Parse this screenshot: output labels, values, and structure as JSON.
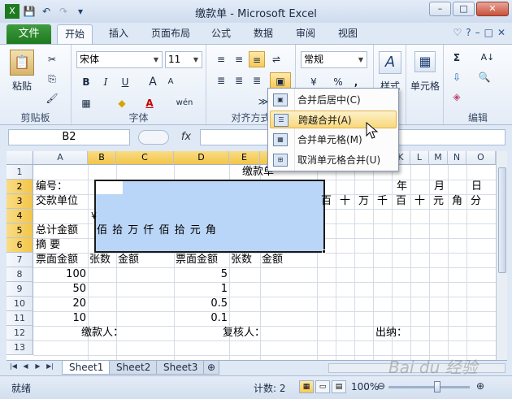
{
  "window": {
    "title": "缴款单 - Microsoft Excel",
    "min": "–",
    "max": "□",
    "close": "✕"
  },
  "qat": {
    "save": "💾",
    "undo": "↶",
    "redo": "↷",
    "more": "▾"
  },
  "tabs": {
    "file": "文件",
    "items": [
      "开始",
      "插入",
      "页面布局",
      "公式",
      "数据",
      "审阅",
      "视图"
    ],
    "active": "开始",
    "icons": [
      "♡",
      "?",
      "–",
      "□",
      "✕"
    ]
  },
  "ribbon": {
    "clipboard": {
      "label": "剪贴板",
      "paste": "粘贴",
      "cut": "✂",
      "copy": "⎘",
      "brush": "🖌"
    },
    "font": {
      "label": "字体",
      "name": "宋体",
      "size": "11",
      "bold": "B",
      "italic": "I",
      "underline": "U",
      "grow": "A",
      "shrink": "A",
      "border": "▦",
      "fill": "◆",
      "color": "A",
      "wen": "wén"
    },
    "align": {
      "label": "对齐方式",
      "wrap": "⇌",
      "merge": "▣",
      "indent": "≫"
    },
    "number": {
      "format": "常规",
      "percent": "%",
      "comma": ",",
      "currency": "¥"
    },
    "styles": {
      "label": "样式",
      "icon": "A"
    },
    "cells": {
      "label": "单元格",
      "icon": "▦"
    },
    "editing": {
      "label": "编辑",
      "sum": "Σ",
      "sort": "A↓",
      "find": "▾",
      "fill": "⇩",
      "clear": "◈"
    }
  },
  "formula_bar": {
    "name_box": "B2",
    "fx": "fx",
    "value": ""
  },
  "columns": [
    "A",
    "B",
    "C",
    "D",
    "E",
    "F",
    "G",
    "H",
    "I",
    "J",
    "K",
    "L",
    "M",
    "N",
    "O"
  ],
  "rows": [
    "1",
    "2",
    "3",
    "4",
    "5",
    "6",
    "7",
    "8",
    "9",
    "10",
    "11",
    "12",
    "13"
  ],
  "cells": {
    "title": "缴款单",
    "a2": "编号：",
    "a3": "交款单位",
    "a5": "总计金额",
    "a6": "摘  要",
    "yuan_sym": "¥",
    "units": "佰 拾 万 仟 佰 拾 元 角",
    "nian": "年",
    "yue": "月",
    "ri": "日",
    "right_units": [
      "百",
      "十",
      "万",
      "千",
      "百",
      "十",
      "元",
      "角",
      "分"
    ],
    "a7": "票面金额",
    "b7": "张数",
    "c7": "金额",
    "d7": "票面金额",
    "e7": "张数",
    "f7": "金额",
    "a8": "100",
    "a9": "50",
    "a10": "20",
    "a11": "10",
    "d8": "5",
    "d9": "1",
    "d10": "0.5",
    "d11": "0.1",
    "b12": "缴款人：",
    "d12": "复核人：",
    "i12": "出纳："
  },
  "merge_menu": {
    "items": [
      "合并后居中(C)",
      "跨越合并(A)",
      "合并单元格(M)",
      "取消单元格合并(U)"
    ],
    "hover": "跨越合并(A)"
  },
  "sheets": {
    "tabs": [
      "Sheet1",
      "Sheet2",
      "Sheet3"
    ],
    "active": "Sheet1",
    "new": "⊕"
  },
  "status": {
    "ready": "就绪",
    "count": "计数: 2",
    "zoom": "100%",
    "minus": "⊖",
    "plus": "⊕"
  },
  "watermark": "Bai du 经验"
}
